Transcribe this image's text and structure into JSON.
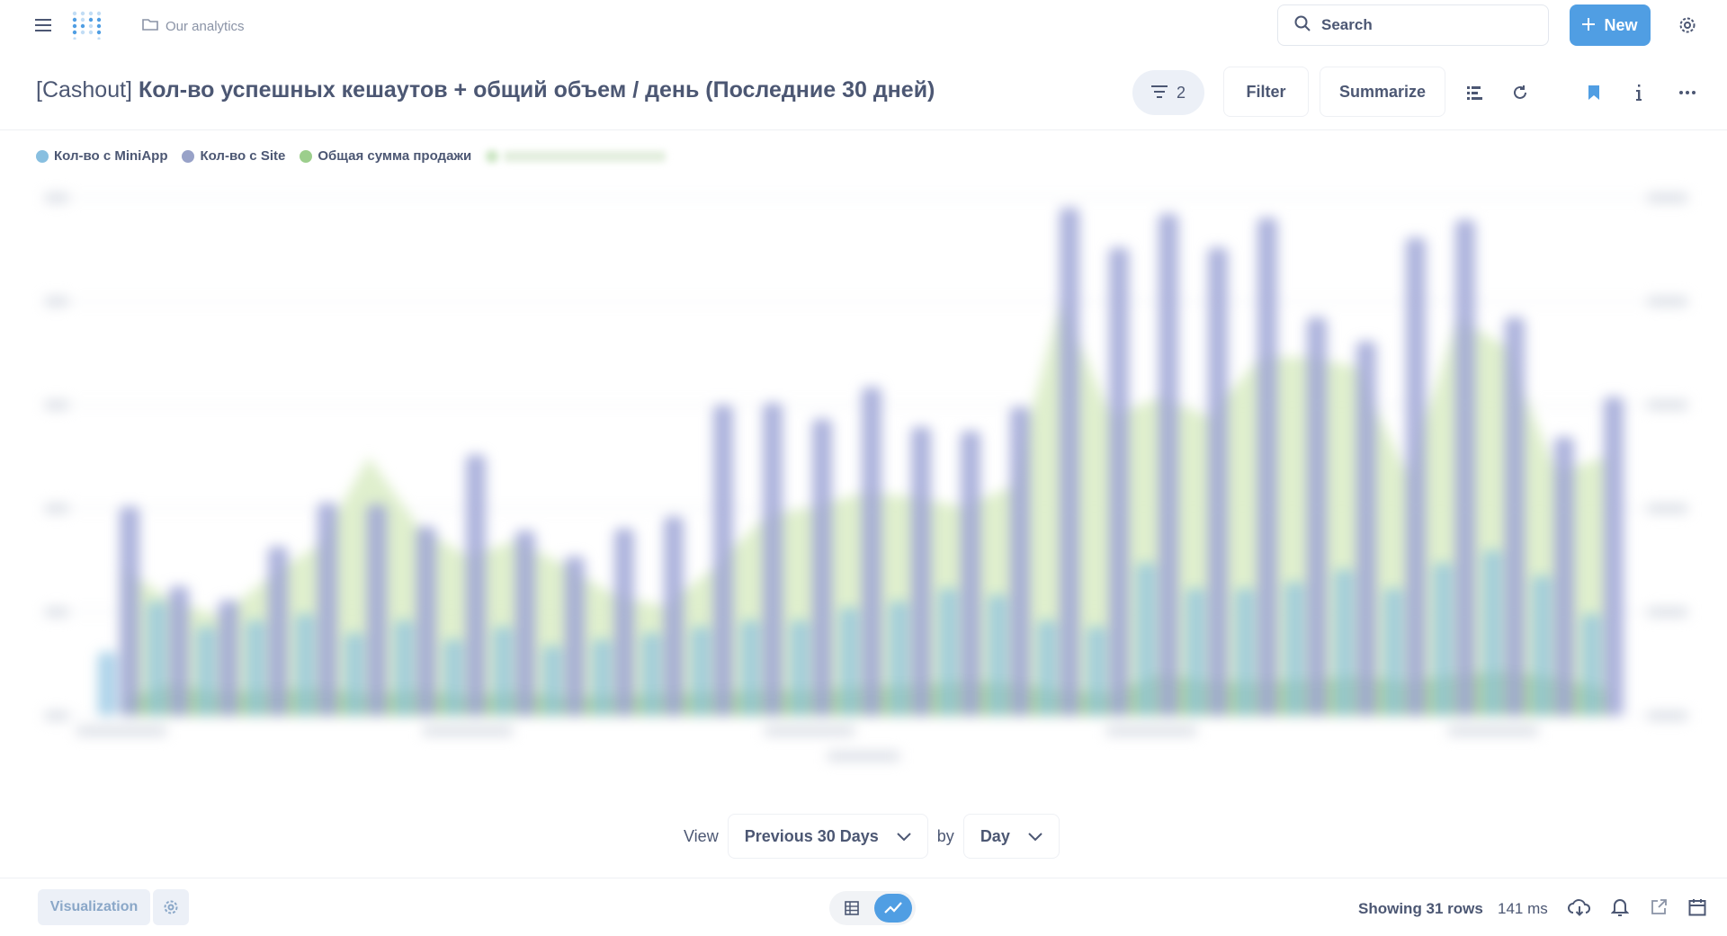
{
  "header": {
    "collection": "Our analytics",
    "search_placeholder": "Search",
    "new_label": "New"
  },
  "question": {
    "tag": "[Cashout]",
    "title": "Кол-во успешных кешаутов + общий объем / день",
    "period": "(Последние 30 дней)",
    "filter_count": "2",
    "filter_label": "Filter",
    "summarize_label": "Summarize"
  },
  "legend": [
    {
      "label": "Кол-во с MiniApp",
      "color": "#88bfe0"
    },
    {
      "label": "Кол-во с Site",
      "color": "#98a2c8"
    },
    {
      "label": "Общая сумма продажи",
      "color": "#9cce8c"
    }
  ],
  "colors": {
    "accent": "#509ee3",
    "miniapp": "#88bfe0",
    "site": "#9ea5d6",
    "total_area": "#dbedc8",
    "small_area": "#a9d296"
  },
  "view_bar": {
    "view_label": "View",
    "period_value": "Previous 30 Days",
    "by_label": "by",
    "unit_value": "Day"
  },
  "footer": {
    "visualization_label": "Visualization",
    "rows_text": "Showing 31 rows",
    "time_text": "141 ms"
  },
  "chart_data": {
    "type": "bar",
    "series": [
      {
        "name": "Кол-во с MiniApp",
        "values": [
          10,
          18,
          14,
          15,
          16,
          13,
          15,
          12,
          14,
          11,
          12,
          13,
          14,
          15,
          15,
          17,
          18,
          20,
          19,
          15,
          14,
          24,
          20,
          20,
          21,
          23,
          20,
          24,
          26,
          22,
          16
        ]
      },
      {
        "name": "Кол-во с Site",
        "values": [
          105,
          65,
          58,
          85,
          107,
          106,
          95,
          131,
          93,
          80,
          94,
          100,
          156,
          157,
          149,
          165,
          145,
          143,
          155,
          255,
          235,
          252,
          235,
          250,
          200,
          188,
          240,
          249,
          200,
          140,
          160
        ]
      },
      {
        "name": "Общая сумма продажи",
        "values": [
          75,
          58,
          50,
          70,
          86,
          130,
          95,
          80,
          88,
          75,
          60,
          55,
          75,
          100,
          105,
          112,
          110,
          105,
          115,
          210,
          150,
          160,
          150,
          180,
          180,
          175,
          120,
          200,
          185,
          122,
          130
        ]
      }
    ]
  }
}
